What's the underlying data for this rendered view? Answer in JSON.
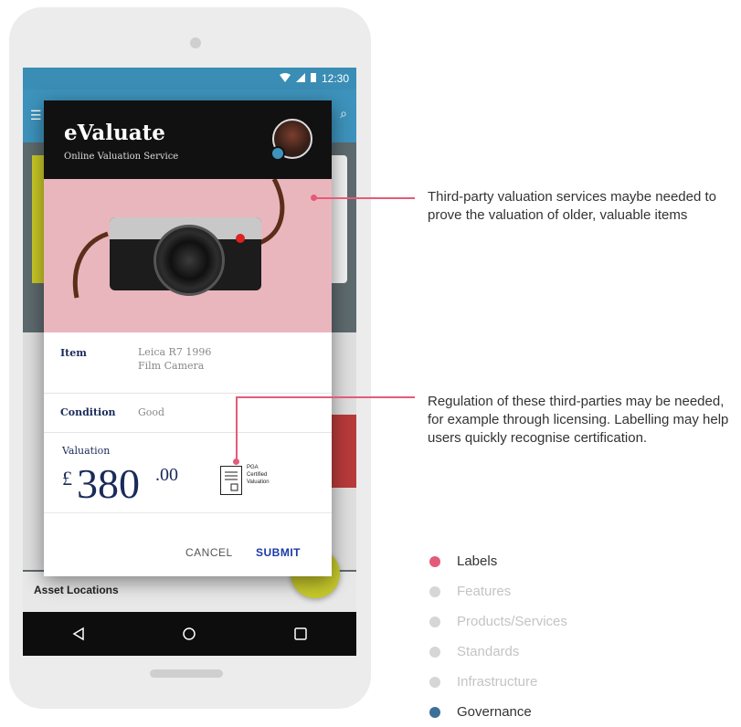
{
  "status_bar": {
    "time": "12:30"
  },
  "dialog": {
    "title": "eValuate",
    "subtitle": "Online Valuation Service",
    "rows": [
      {
        "label": "Item",
        "value_line1": "Leica R7 1996",
        "value_line2": "Film Camera"
      },
      {
        "label": "Condition",
        "value_line1": "Good"
      }
    ],
    "valuation": {
      "label": "Valuation",
      "currency": "£",
      "amount": "380",
      "decimals": ".00"
    },
    "certification": {
      "line1": "PGA",
      "line2": "Certified",
      "line3": "Valuation"
    },
    "actions": {
      "cancel": "CANCEL",
      "submit": "SUBMIT"
    }
  },
  "background_app": {
    "asset_locations": "Asset Locations"
  },
  "annotations": [
    {
      "text": "Third-party valuation services maybe needed to prove the valuation of older, valuable items"
    },
    {
      "text": "Regulation of these third-parties may be needed, for example through licensing. Labelling may help users quickly recognise certification."
    }
  ],
  "legend": [
    {
      "label": "Labels",
      "color": "#e45b7a",
      "text_color": "#333333"
    },
    {
      "label": "Features",
      "color": "#d6d6d6",
      "text_color": "#c4c4c4"
    },
    {
      "label": "Products/Services",
      "color": "#d6d6d6",
      "text_color": "#c4c4c4"
    },
    {
      "label": "Standards",
      "color": "#d6d6d6",
      "text_color": "#c4c4c4"
    },
    {
      "label": "Infrastructure",
      "color": "#d6d6d6",
      "text_color": "#c4c4c4"
    },
    {
      "label": "Governance",
      "color": "#3d6f98",
      "text_color": "#333333"
    }
  ],
  "colors": {
    "accent": "#e45b7a",
    "primary_dark": "#1a2a5a",
    "submit": "#1a3aa8"
  }
}
